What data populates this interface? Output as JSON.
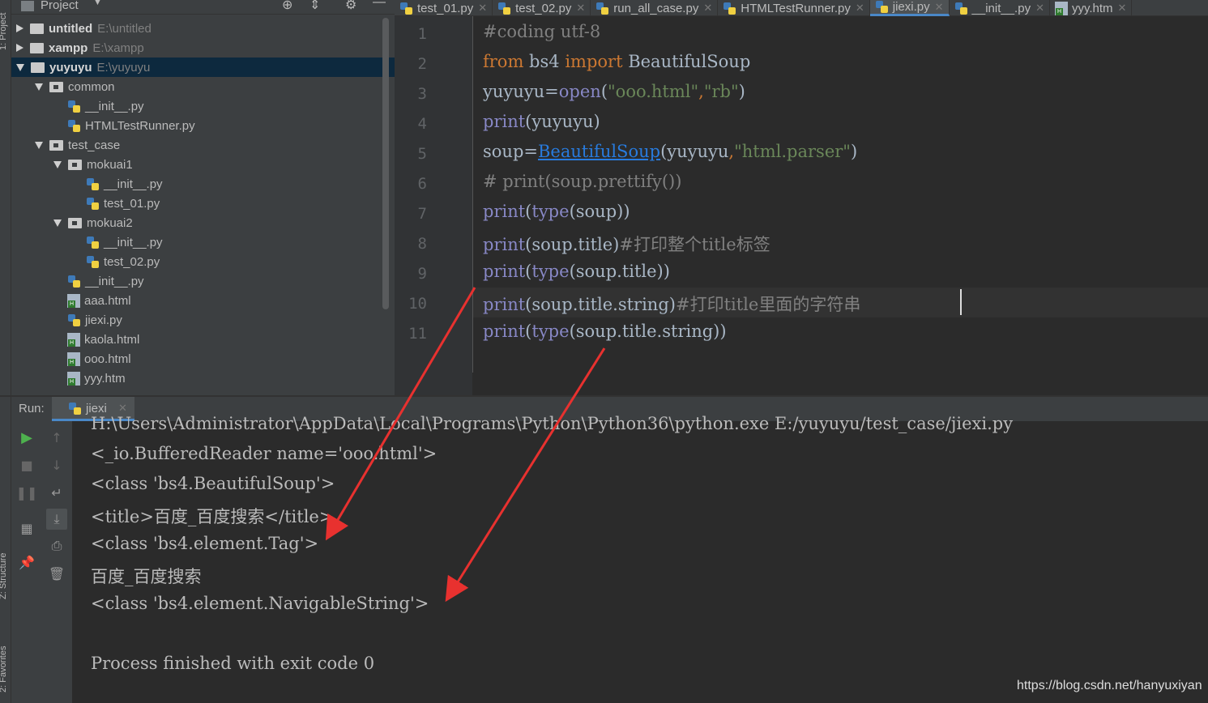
{
  "side": {
    "project_label": "1: Project",
    "structure_label": "Z: Structure",
    "favorites_label": "2: Favorites"
  },
  "project_header": {
    "title": "Project"
  },
  "tree": [
    {
      "label": "untitled",
      "path": "E:\\untitled",
      "depth": 0,
      "type": "root",
      "arrow": "right"
    },
    {
      "label": "xampp",
      "path": "E:\\xampp",
      "depth": 0,
      "type": "root",
      "arrow": "right"
    },
    {
      "label": "yuyuyu",
      "path": "E:\\yuyuyu",
      "depth": 0,
      "type": "root",
      "arrow": "down",
      "selected": true
    },
    {
      "label": "common",
      "depth": 1,
      "type": "module",
      "arrow": "down"
    },
    {
      "label": "__init__.py",
      "depth": 2,
      "type": "py"
    },
    {
      "label": "HTMLTestRunner.py",
      "depth": 2,
      "type": "py"
    },
    {
      "label": "test_case",
      "depth": 1,
      "type": "module",
      "arrow": "down"
    },
    {
      "label": "mokuai1",
      "depth": 2,
      "type": "module",
      "arrow": "down"
    },
    {
      "label": "__init__.py",
      "depth": 3,
      "type": "py"
    },
    {
      "label": "test_01.py",
      "depth": 3,
      "type": "py"
    },
    {
      "label": "mokuai2",
      "depth": 2,
      "type": "module",
      "arrow": "down"
    },
    {
      "label": "__init__.py",
      "depth": 3,
      "type": "py"
    },
    {
      "label": "test_02.py",
      "depth": 3,
      "type": "py"
    },
    {
      "label": "__init__.py",
      "depth": 2,
      "type": "py"
    },
    {
      "label": "aaa.html",
      "depth": 2,
      "type": "html"
    },
    {
      "label": "jiexi.py",
      "depth": 2,
      "type": "py"
    },
    {
      "label": "kaola.html",
      "depth": 2,
      "type": "html"
    },
    {
      "label": "ooo.html",
      "depth": 2,
      "type": "html"
    },
    {
      "label": "yyy.htm",
      "depth": 2,
      "type": "html"
    }
  ],
  "tabs": [
    {
      "label": "test_01.py",
      "type": "py"
    },
    {
      "label": "test_02.py",
      "type": "py"
    },
    {
      "label": "run_all_case.py",
      "type": "py"
    },
    {
      "label": "HTMLTestRunner.py",
      "type": "py"
    },
    {
      "label": "jiexi.py",
      "type": "py",
      "active": true
    },
    {
      "label": "__init__.py",
      "type": "py"
    },
    {
      "label": "yyy.htm",
      "type": "html"
    }
  ],
  "editor": {
    "line_numbers": [
      "1",
      "2",
      "3",
      "4",
      "5",
      "6",
      "7",
      "8",
      "9",
      "10",
      "11"
    ],
    "lines": [
      [
        {
          "t": "#coding utf-8",
          "c": "cm"
        }
      ],
      [
        {
          "t": "from",
          "c": "kw"
        },
        {
          "t": " bs4 ",
          "c": ""
        },
        {
          "t": "import",
          "c": "kw"
        },
        {
          "t": " BeautifulSoup",
          "c": ""
        }
      ],
      [
        {
          "t": "yuyuyu=",
          "c": ""
        },
        {
          "t": "open",
          "c": "fn"
        },
        {
          "t": "(",
          "c": ""
        },
        {
          "t": "\"ooo.html\"",
          "c": "str"
        },
        {
          "t": ",",
          "c": "kw"
        },
        {
          "t": "\"rb\"",
          "c": "str"
        },
        {
          "t": ")",
          "c": ""
        }
      ],
      [
        {
          "t": "print",
          "c": "fn"
        },
        {
          "t": "(yuyuyu)",
          "c": ""
        }
      ],
      [
        {
          "t": "soup=",
          "c": ""
        },
        {
          "t": "BeautifulSoup",
          "c": "lnk"
        },
        {
          "t": "(yuyuyu",
          "c": ""
        },
        {
          "t": ",",
          "c": "kw"
        },
        {
          "t": "\"html.parser\"",
          "c": "str"
        },
        {
          "t": ")",
          "c": ""
        }
      ],
      [
        {
          "t": "# print(soup.prettify())",
          "c": "cm"
        }
      ],
      [
        {
          "t": "print",
          "c": "fn"
        },
        {
          "t": "(",
          "c": ""
        },
        {
          "t": "type",
          "c": "fn"
        },
        {
          "t": "(soup))",
          "c": ""
        }
      ],
      [
        {
          "t": "print",
          "c": "fn"
        },
        {
          "t": "(soup.title)",
          "c": ""
        },
        {
          "t": "#打印整个title标签",
          "c": "cm"
        }
      ],
      [
        {
          "t": "print",
          "c": "fn"
        },
        {
          "t": "(",
          "c": ""
        },
        {
          "t": "type",
          "c": "fn"
        },
        {
          "t": "(soup.title))",
          "c": ""
        }
      ],
      [
        {
          "t": "print",
          "c": "fn"
        },
        {
          "t": "(soup.title.string)",
          "c": ""
        },
        {
          "t": "#打印title里面的字符串",
          "c": "cm"
        }
      ],
      [
        {
          "t": "print",
          "c": "fn"
        },
        {
          "t": "(",
          "c": ""
        },
        {
          "t": "type",
          "c": "fn"
        },
        {
          "t": "(soup.title.string))",
          "c": ""
        }
      ]
    ]
  },
  "run": {
    "label": "Run:",
    "tab_label": "jiexi"
  },
  "console": [
    "H:\\Users\\Administrator\\AppData\\Local\\Programs\\Python\\Python36\\python.exe E:/yuyuyu/test_case/jiexi.py",
    "<_io.BufferedReader name='ooo.html'>",
    "<class 'bs4.BeautifulSoup'>",
    "<title>百度_百度搜索</title>",
    "<class 'bs4.element.Tag'>",
    "百度_百度搜索",
    "<class 'bs4.element.NavigableString'>",
    "",
    "Process finished with exit code 0"
  ],
  "watermark": "https://blog.csdn.net/hanyuxiyan",
  "colors": {
    "arrow": "#e8312f",
    "accent": "#4a88c7"
  }
}
